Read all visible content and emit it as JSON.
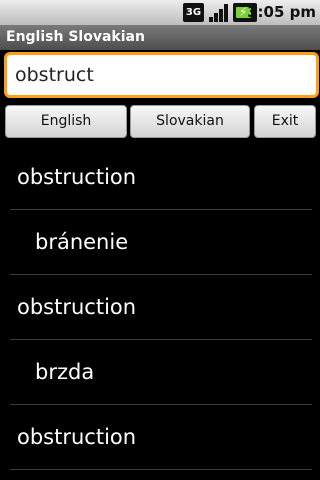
{
  "status_bar": {
    "network_label": "3G",
    "time": "3:05 pm"
  },
  "app": {
    "title": "English Slovakian"
  },
  "search": {
    "value": "obstruct"
  },
  "buttons": {
    "english": "English",
    "slovakian": "Slovakian",
    "exit": "Exit"
  },
  "results": [
    {
      "text": "obstruction",
      "kind": "headword"
    },
    {
      "text": "bránenie",
      "kind": "translation"
    },
    {
      "text": "obstruction",
      "kind": "headword"
    },
    {
      "text": "brzda",
      "kind": "translation"
    },
    {
      "text": "obstruction",
      "kind": "headword"
    }
  ],
  "colors": {
    "accent_focus": "#ff9e1a",
    "background": "#000000",
    "battery_green": "#7bd233"
  }
}
